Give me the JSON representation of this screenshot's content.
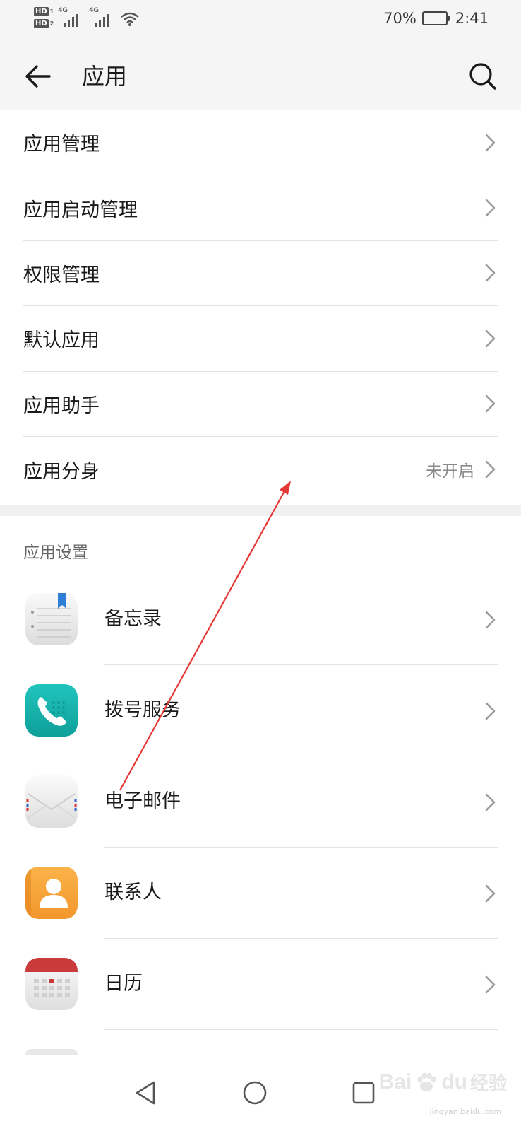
{
  "status_bar": {
    "sim1": "HD",
    "sim1_num": "1",
    "sim2": "HD",
    "sim2_num": "2",
    "net1": "4G",
    "net2": "4G",
    "battery_percent": "70%",
    "battery_level": 0.7,
    "time": "2:41"
  },
  "header": {
    "title": "应用",
    "back_icon": "arrow-left-icon",
    "search_icon": "search-icon"
  },
  "menu": {
    "items": [
      {
        "label": "应用管理",
        "value": ""
      },
      {
        "label": "应用启动管理",
        "value": ""
      },
      {
        "label": "权限管理",
        "value": ""
      },
      {
        "label": "默认应用",
        "value": ""
      },
      {
        "label": "应用助手",
        "value": ""
      },
      {
        "label": "应用分身",
        "value": "未开启"
      }
    ]
  },
  "app_settings": {
    "title": "应用设置",
    "items": [
      {
        "label": "备忘录",
        "icon": "notepad-icon"
      },
      {
        "label": "拨号服务",
        "icon": "phone-icon"
      },
      {
        "label": "电子邮件",
        "icon": "mail-icon"
      },
      {
        "label": "联系人",
        "icon": "contacts-icon"
      },
      {
        "label": "日历",
        "icon": "calendar-icon"
      }
    ]
  },
  "colors": {
    "header_bg": "#f5f5f5",
    "annotation_arrow": "#e53935",
    "phone_teal": "#14b3ad",
    "contacts_orange": "#f7a53b",
    "calendar_red": "#c93a3a"
  },
  "watermark": {
    "brand": "Bai",
    "brand2": "du",
    "site": "经验",
    "url": "jingyan.baidu.com"
  }
}
